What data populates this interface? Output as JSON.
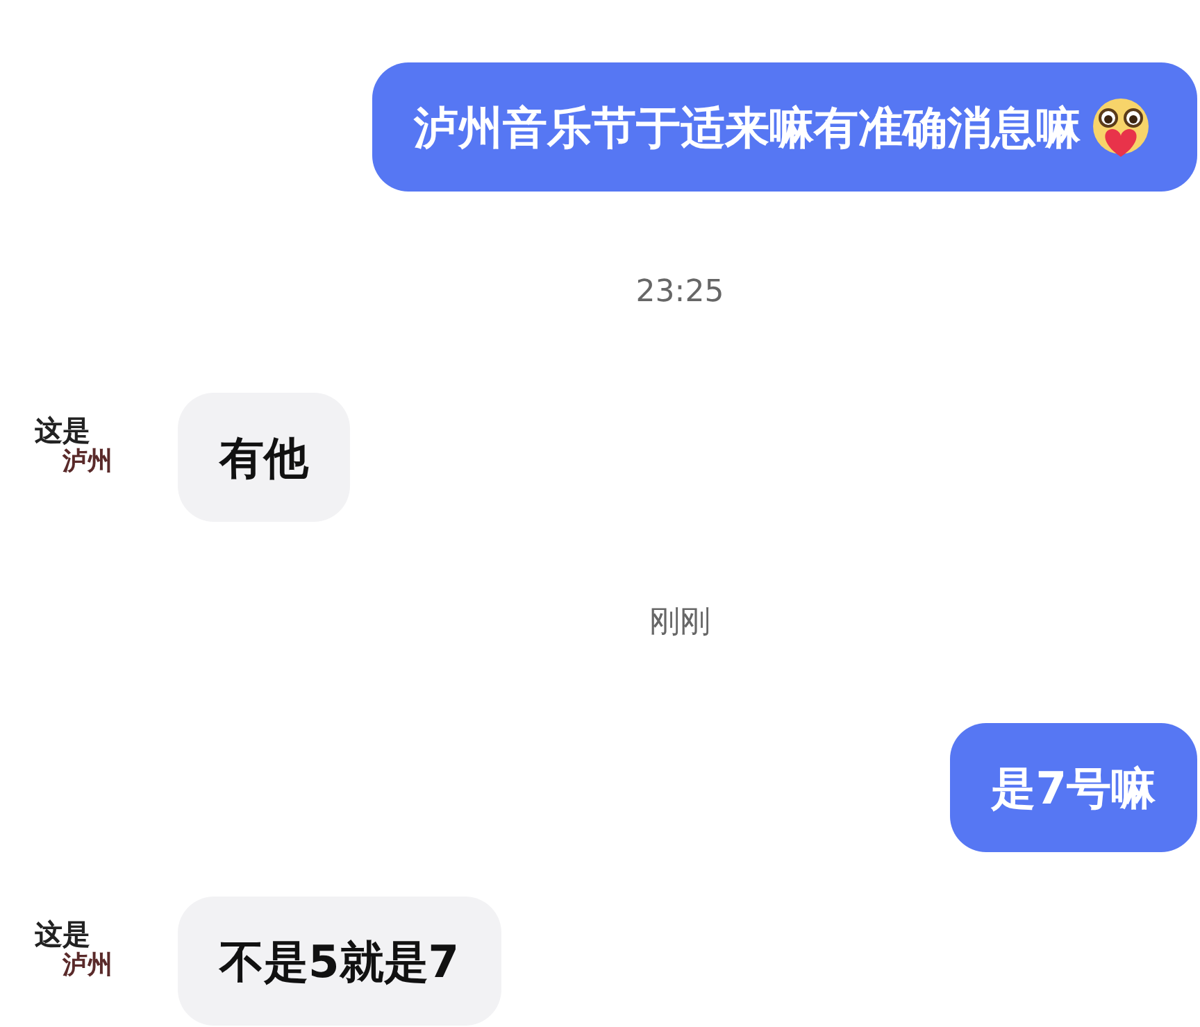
{
  "messages": [
    {
      "kind": "sent",
      "text": "泸州音乐节于适来嘛有准确消息嘛",
      "emoji": true
    },
    {
      "kind": "time",
      "text": "23:25"
    },
    {
      "kind": "received",
      "avatar": [
        "这是",
        "泸州"
      ],
      "text": "有他"
    },
    {
      "kind": "time",
      "text": "刚刚"
    },
    {
      "kind": "sent",
      "text": "是7号嘛"
    },
    {
      "kind": "received",
      "avatar": [
        "这是",
        "泸州"
      ],
      "text": "不是5就是7"
    }
  ]
}
